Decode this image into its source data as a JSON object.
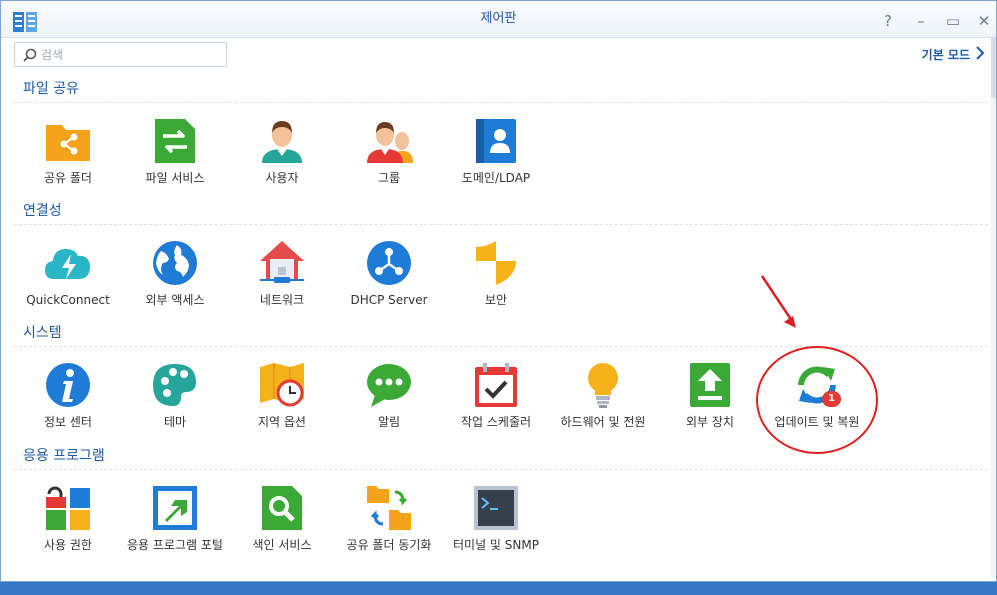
{
  "window": {
    "title": "제어판",
    "help_symbol": "?",
    "minimize_symbol": "–",
    "maximize_symbol": "▭",
    "close_symbol": "✕"
  },
  "search": {
    "placeholder": "검색",
    "value": ""
  },
  "basic_mode": {
    "label": "기본 모드"
  },
  "sections": [
    {
      "title": "파일 공유",
      "items": [
        {
          "label": "공유 폴더",
          "icon": "shared-folder-icon",
          "color": "#f5a31a"
        },
        {
          "label": "파일 서비스",
          "icon": "file-services-icon",
          "color": "#3aa935"
        },
        {
          "label": "사용자",
          "icon": "user-icon",
          "color": "#26a69a"
        },
        {
          "label": "그룹",
          "icon": "group-icon",
          "color": "#e53935"
        },
        {
          "label": "도메인/LDAP",
          "icon": "domain-ldap-icon",
          "color": "#1e7bd6"
        }
      ]
    },
    {
      "title": "연결성",
      "items": [
        {
          "label": "QuickConnect",
          "icon": "quickconnect-icon",
          "color": "#2bb6c7"
        },
        {
          "label": "외부 액세스",
          "icon": "external-access-icon",
          "color": "#1e7bd6"
        },
        {
          "label": "네트워크",
          "icon": "network-icon",
          "color": "#e54b4b"
        },
        {
          "label": "DHCP Server",
          "icon": "dhcp-server-icon",
          "color": "#1e7bd6"
        },
        {
          "label": "보안",
          "icon": "security-shield-icon",
          "color": "#f5b21a"
        }
      ]
    },
    {
      "title": "시스템",
      "items": [
        {
          "label": "정보 센터",
          "icon": "info-center-icon",
          "color": "#1e7bd6"
        },
        {
          "label": "테마",
          "icon": "theme-palette-icon",
          "color": "#26a69a"
        },
        {
          "label": "지역 옵션",
          "icon": "regional-options-icon",
          "color": "#f5b21a"
        },
        {
          "label": "알림",
          "icon": "notification-icon",
          "color": "#3aa935"
        },
        {
          "label": "작업 스케줄러",
          "icon": "task-scheduler-icon",
          "color": "#e53935"
        },
        {
          "label": "하드웨어 및 전원",
          "icon": "hardware-power-icon",
          "color": "#f5b21a"
        },
        {
          "label": "외부 장치",
          "icon": "external-devices-icon",
          "color": "#3aa935"
        },
        {
          "label": "업데이트 및 복원",
          "icon": "update-restore-icon",
          "color": "#1e7bd6",
          "badge": "1"
        }
      ]
    },
    {
      "title": "응용 프로그램",
      "items": [
        {
          "label": "사용 권한",
          "icon": "privileges-icon",
          "color": "#e53935"
        },
        {
          "label": "응용 프로그램 포털",
          "icon": "application-portal-icon",
          "color": "#1e7bd6"
        },
        {
          "label": "색인 서비스",
          "icon": "indexing-service-icon",
          "color": "#3aa935"
        },
        {
          "label": "공유 폴더 동기화",
          "icon": "shared-folder-sync-icon",
          "color": "#f5b21a"
        },
        {
          "label": "터미널 및 SNMP",
          "icon": "terminal-snmp-icon",
          "color": "#4a5a6a"
        }
      ]
    }
  ]
}
